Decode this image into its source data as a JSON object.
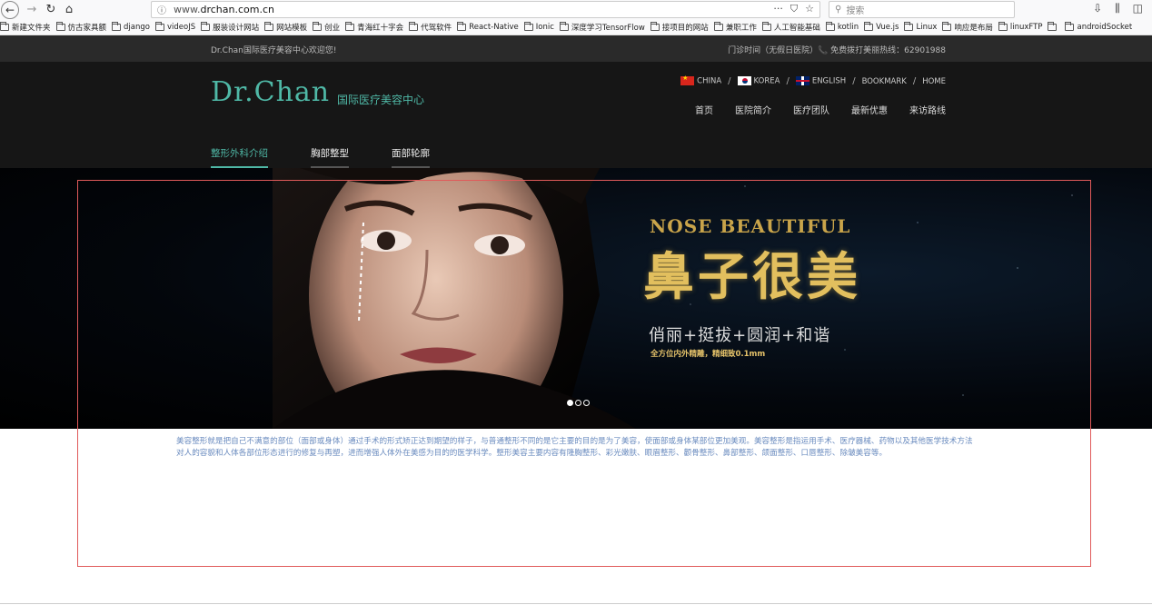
{
  "browser": {
    "url_prefix": "www.",
    "url_domain": "drchan.com.cn",
    "more_label": "···",
    "search_placeholder": "搜索",
    "bookmarks": [
      "新建文件夹",
      "仿古家具额",
      "django",
      "videoJS",
      "服装设计网站",
      "网站模板",
      "创业",
      "青海红十字会",
      "代驾软件",
      "React-Native",
      "Ionic",
      "深度学习TensorFlow",
      "接项目的网站",
      "兼职工作",
      "人工智能基础",
      "kotlin",
      "Vue.js",
      "Linux",
      "响应是布局",
      "linuxFTP",
      "",
      "androidSocket"
    ]
  },
  "site": {
    "welcome": "Dr.Chan国际医疗美容中心欢迎您!",
    "hours": "门诊时间（无假日医院）📞 免费拨打美丽热线：62901988",
    "logo": "Dr.Chan",
    "logo_sub": "国际医疗美容中心",
    "lang": {
      "china": "CHINA",
      "korea": "KOREA",
      "english": "ENGLISH",
      "bookmark": "BOOKMARK",
      "home": "HOME",
      "sep": "/"
    },
    "mainnav": [
      "首页",
      "医院简介",
      "医疗团队",
      "最新优惠",
      "来访路线"
    ],
    "subnav": [
      "整形外科介绍",
      "胸部整型",
      "面部轮廓"
    ],
    "hero": {
      "title_en": "NOSE BEAUTIFUL",
      "title_cn": "鼻子很美",
      "subtitle": "俏丽+挺拔+圆润+和谐",
      "small": "全方位内外精雕，精细致0.1mm"
    },
    "description": "美容整形就是把自己不满意的部位（面部或身体）通过手术的形式矫正达到期望的样子，与普通整形不同的是它主要的目的是为了美容，使面部或身体某部位更加美观。美容整形是指运用手术、医疗器械、药物以及其他医学技术方法对人的容貌和人体各部位形态进行的修复与再塑，进而增强人体外在美感为目的的医学科学。整形美容主要内容有隆胸整形、彩光嫩肤、眼眉整形、颧骨整形、鼻部整形、颌面整形、口唇整形、除皱美容等。"
  }
}
